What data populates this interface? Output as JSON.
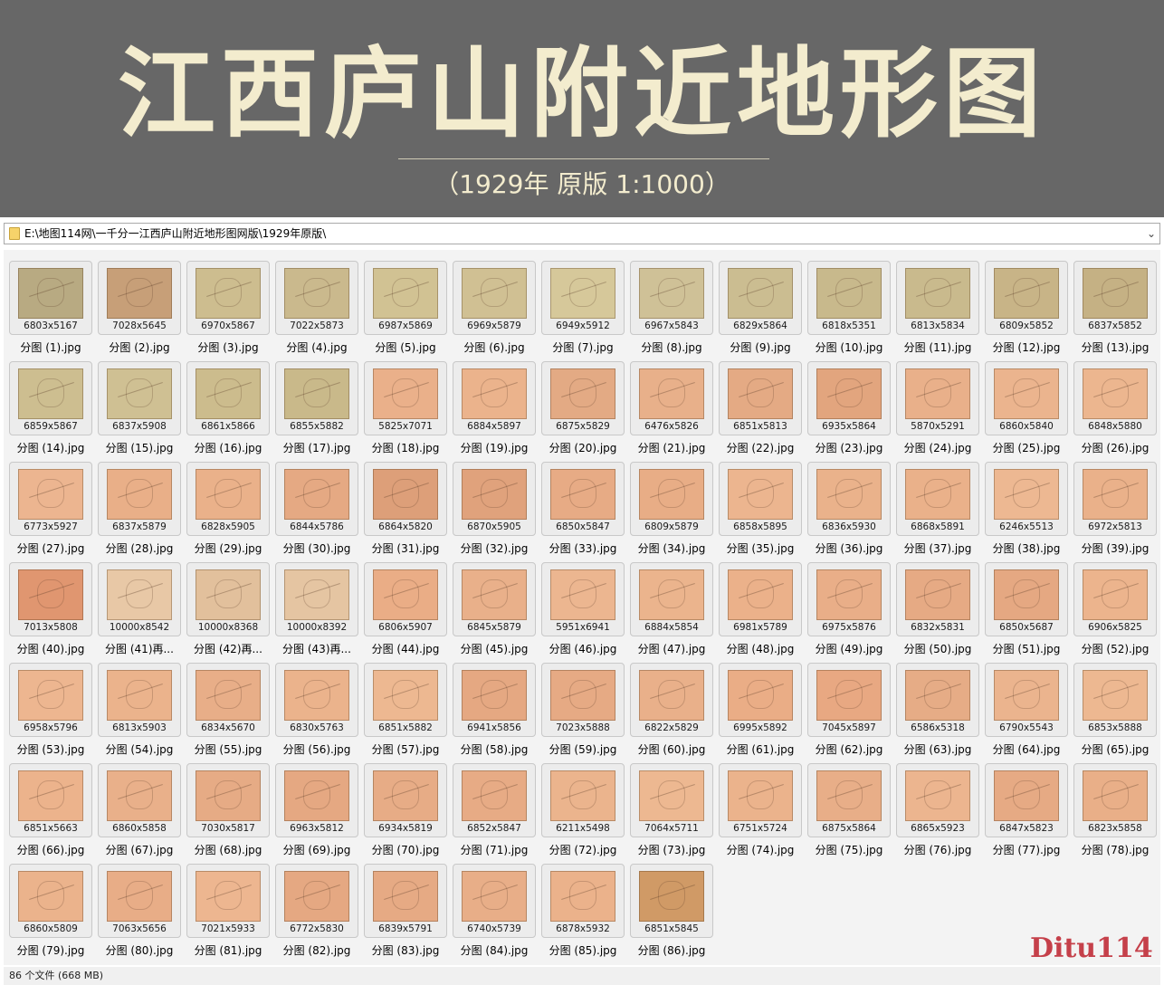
{
  "banner": {
    "title": "江西庐山附近地形图",
    "subtitle": "（1929年 原版  1:1000）"
  },
  "addressbar": {
    "path": "E:\\地图114网\\一千分一江西庐山附近地形图网版\\1929年原版\\",
    "dropdown_icon": "chevron-down-icon"
  },
  "colors": {
    "banner_bg": "#676767",
    "banner_text": "#f3ecce",
    "watermark": "#c5404a",
    "map_green": "#c2b78f",
    "map_orange": "#e9ad86",
    "map_red": "#dc8b66"
  },
  "files": [
    {
      "dims": "6803x5167",
      "name": "分图 (1).jpg",
      "tone": "#b8aa82"
    },
    {
      "dims": "7028x5645",
      "name": "分图 (2).jpg",
      "tone": "#c79f78"
    },
    {
      "dims": "6970x5867",
      "name": "分图 (3).jpg",
      "tone": "#cdbd8f"
    },
    {
      "dims": "7022x5873",
      "name": "分图 (4).jpg",
      "tone": "#cab98d"
    },
    {
      "dims": "6987x5869",
      "name": "分图 (5).jpg",
      "tone": "#d1c293"
    },
    {
      "dims": "6969x5879",
      "name": "分图 (6).jpg",
      "tone": "#d0c093"
    },
    {
      "dims": "6949x5912",
      "name": "分图 (7).jpg",
      "tone": "#d6c89a"
    },
    {
      "dims": "6967x5843",
      "name": "分图 (8).jpg",
      "tone": "#cfc197"
    },
    {
      "dims": "6829x5864",
      "name": "分图 (9).jpg",
      "tone": "#cbbd91"
    },
    {
      "dims": "6818x5351",
      "name": "分图 (10).jpg",
      "tone": "#c8b98c"
    },
    {
      "dims": "6813x5834",
      "name": "分图 (11).jpg",
      "tone": "#c9ba8d"
    },
    {
      "dims": "6809x5852",
      "name": "分图 (12).jpg",
      "tone": "#c8b487"
    },
    {
      "dims": "6837x5852",
      "name": "分图 (13).jpg",
      "tone": "#c5b184"
    },
    {
      "dims": "6859x5867",
      "name": "分图 (14).jpg",
      "tone": "#cdbe90"
    },
    {
      "dims": "6837x5908",
      "name": "分图 (15).jpg",
      "tone": "#cfc093"
    },
    {
      "dims": "6861x5866",
      "name": "分图 (16).jpg",
      "tone": "#ccbc8d"
    },
    {
      "dims": "6855x5882",
      "name": "分图 (17).jpg",
      "tone": "#c9b98a"
    },
    {
      "dims": "5825x7071",
      "name": "分图 (18).jpg",
      "tone": "#eab08a"
    },
    {
      "dims": "6884x5897",
      "name": "分图 (19).jpg",
      "tone": "#ebb38c"
    },
    {
      "dims": "6875x5829",
      "name": "分图 (20).jpg",
      "tone": "#e3aa84"
    },
    {
      "dims": "6476x5826",
      "name": "分图 (21).jpg",
      "tone": "#e8b08a"
    },
    {
      "dims": "6851x5813",
      "name": "分图 (22).jpg",
      "tone": "#e4aa84"
    },
    {
      "dims": "6935x5864",
      "name": "分图 (23).jpg",
      "tone": "#e2a57e"
    },
    {
      "dims": "5870x5291",
      "name": "分图 (24).jpg",
      "tone": "#e9b08a"
    },
    {
      "dims": "6860x5840",
      "name": "分图 (25).jpg",
      "tone": "#ebb48e"
    },
    {
      "dims": "6848x5880",
      "name": "分图 (26).jpg",
      "tone": "#ecb68f"
    },
    {
      "dims": "6773x5927",
      "name": "分图 (27).jpg",
      "tone": "#ecb590"
    },
    {
      "dims": "6837x5879",
      "name": "分图 (28).jpg",
      "tone": "#e9af88"
    },
    {
      "dims": "6828x5905",
      "name": "分图 (29).jpg",
      "tone": "#eab18a"
    },
    {
      "dims": "6844x5786",
      "name": "分图 (30).jpg",
      "tone": "#e5a983"
    },
    {
      "dims": "6864x5820",
      "name": "分图 (31).jpg",
      "tone": "#dd9f79"
    },
    {
      "dims": "6870x5905",
      "name": "分图 (32).jpg",
      "tone": "#e0a27c"
    },
    {
      "dims": "6850x5847",
      "name": "分图 (33).jpg",
      "tone": "#e7ab85"
    },
    {
      "dims": "6809x5879",
      "name": "分图 (34).jpg",
      "tone": "#e8ad86"
    },
    {
      "dims": "6858x5895",
      "name": "分图 (35).jpg",
      "tone": "#ecb58f"
    },
    {
      "dims": "6836x5930",
      "name": "分图 (36).jpg",
      "tone": "#eab28b"
    },
    {
      "dims": "6868x5891",
      "name": "分图 (37).jpg",
      "tone": "#eab18a"
    },
    {
      "dims": "6246x5513",
      "name": "分图 (38).jpg",
      "tone": "#edb892"
    },
    {
      "dims": "6972x5813",
      "name": "分图 (39).jpg",
      "tone": "#eab18a"
    },
    {
      "dims": "7013x5808",
      "name": "分图 (40).jpg",
      "tone": "#e09670"
    },
    {
      "dims": "10000x8542",
      "name": "分图 (41)再...",
      "tone": "#e8c8a6"
    },
    {
      "dims": "10000x8368",
      "name": "分图 (42)再...",
      "tone": "#e2c09c"
    },
    {
      "dims": "10000x8392",
      "name": "分图 (43)再...",
      "tone": "#e5c5a2"
    },
    {
      "dims": "6806x5907",
      "name": "分图 (44).jpg",
      "tone": "#eaad86"
    },
    {
      "dims": "6845x5879",
      "name": "分图 (45).jpg",
      "tone": "#e9b08a"
    },
    {
      "dims": "5951x6941",
      "name": "分图 (46).jpg",
      "tone": "#ecb690"
    },
    {
      "dims": "6884x5854",
      "name": "分图 (47).jpg",
      "tone": "#ebb48d"
    },
    {
      "dims": "6981x5789",
      "name": "分图 (48).jpg",
      "tone": "#ebb18a"
    },
    {
      "dims": "6975x5876",
      "name": "分图 (49).jpg",
      "tone": "#e9ae88"
    },
    {
      "dims": "6832x5831",
      "name": "分图 (50).jpg",
      "tone": "#e6aa84"
    },
    {
      "dims": "6850x5687",
      "name": "分图 (51).jpg",
      "tone": "#e5a882"
    },
    {
      "dims": "6906x5825",
      "name": "分图 (52).jpg",
      "tone": "#ecb48d"
    },
    {
      "dims": "6958x5796",
      "name": "分图 (53).jpg",
      "tone": "#edb690"
    },
    {
      "dims": "6813x5903",
      "name": "分图 (54).jpg",
      "tone": "#ebb38c"
    },
    {
      "dims": "6834x5670",
      "name": "分图 (55).jpg",
      "tone": "#e8ae88"
    },
    {
      "dims": "6830x5763",
      "name": "分图 (56).jpg",
      "tone": "#ebb38c"
    },
    {
      "dims": "6851x5882",
      "name": "分图 (57).jpg",
      "tone": "#edb891"
    },
    {
      "dims": "6941x5856",
      "name": "分图 (58).jpg",
      "tone": "#e5a882"
    },
    {
      "dims": "7023x5888",
      "name": "分图 (59).jpg",
      "tone": "#e6aa84"
    },
    {
      "dims": "6822x5829",
      "name": "分图 (60).jpg",
      "tone": "#e9b08a"
    },
    {
      "dims": "6995x5892",
      "name": "分图 (61).jpg",
      "tone": "#eaad86"
    },
    {
      "dims": "7045x5897",
      "name": "分图 (62).jpg",
      "tone": "#e8a882"
    },
    {
      "dims": "6586x5318",
      "name": "分图 (63).jpg",
      "tone": "#e6ac86"
    },
    {
      "dims": "6790x5543",
      "name": "分图 (64).jpg",
      "tone": "#ebb48e"
    },
    {
      "dims": "6853x5888",
      "name": "分图 (65).jpg",
      "tone": "#edb891"
    },
    {
      "dims": "6851x5663",
      "name": "分图 (66).jpg",
      "tone": "#ecb38c"
    },
    {
      "dims": "6860x5858",
      "name": "分图 (67).jpg",
      "tone": "#e9b08a"
    },
    {
      "dims": "7030x5817",
      "name": "分图 (68).jpg",
      "tone": "#e6ab85"
    },
    {
      "dims": "6963x5812",
      "name": "分图 (69).jpg",
      "tone": "#e5a882"
    },
    {
      "dims": "6934x5819",
      "name": "分图 (70).jpg",
      "tone": "#e7ac86"
    },
    {
      "dims": "6852x5847",
      "name": "分图 (71).jpg",
      "tone": "#e7ab85"
    },
    {
      "dims": "6211x5498",
      "name": "分图 (72).jpg",
      "tone": "#ebb48d"
    },
    {
      "dims": "7064x5711",
      "name": "分图 (73).jpg",
      "tone": "#edb891"
    },
    {
      "dims": "6751x5724",
      "name": "分图 (74).jpg",
      "tone": "#ebb38c"
    },
    {
      "dims": "6875x5864",
      "name": "分图 (75).jpg",
      "tone": "#e8ae88"
    },
    {
      "dims": "6865x5923",
      "name": "分图 (76).jpg",
      "tone": "#ecb58f"
    },
    {
      "dims": "6847x5823",
      "name": "分图 (77).jpg",
      "tone": "#e6aa84"
    },
    {
      "dims": "6823x5858",
      "name": "分图 (78).jpg",
      "tone": "#e9af88"
    },
    {
      "dims": "6860x5809",
      "name": "分图 (79).jpg",
      "tone": "#ebb38c"
    },
    {
      "dims": "7063x5656",
      "name": "分图 (80).jpg",
      "tone": "#e8ad87"
    },
    {
      "dims": "7021x5933",
      "name": "分图 (81).jpg",
      "tone": "#edb690"
    },
    {
      "dims": "6772x5830",
      "name": "分图 (82).jpg",
      "tone": "#e5a882"
    },
    {
      "dims": "6839x5791",
      "name": "分图 (83).jpg",
      "tone": "#e6aa84"
    },
    {
      "dims": "6740x5739",
      "name": "分图 (84).jpg",
      "tone": "#e8ae88"
    },
    {
      "dims": "6878x5932",
      "name": "分图 (85).jpg",
      "tone": "#ebb28b"
    },
    {
      "dims": "6851x5845",
      "name": "分图 (86).jpg",
      "tone": "#d09a66"
    }
  ],
  "statusbar": {
    "count_text": "86 个文件 (668 MB)"
  },
  "watermark": {
    "text": "Ditu114"
  }
}
